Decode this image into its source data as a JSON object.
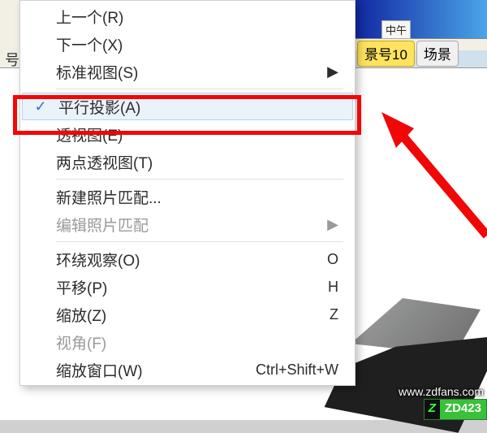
{
  "app": {
    "time_indicator": "中午"
  },
  "toolbar": {
    "tab_active": "景号10",
    "tab_next": "场景",
    "left_label": "号"
  },
  "menu": {
    "items": [
      {
        "label": "上一个(R)",
        "shortcut": "",
        "checked": false,
        "disabled": false
      },
      {
        "label": "下一个(X)",
        "shortcut": "",
        "checked": false,
        "disabled": false
      },
      {
        "label": "标准视图(S)",
        "shortcut": "",
        "checked": false,
        "disabled": false,
        "submenu": true
      }
    ],
    "sep1": true,
    "items2": [
      {
        "label": "平行投影(A)",
        "shortcut": "",
        "checked": true,
        "disabled": false
      },
      {
        "label": "透视图(E)",
        "shortcut": "",
        "checked": false,
        "disabled": false
      },
      {
        "label": "两点透视图(T)",
        "shortcut": "",
        "checked": false,
        "disabled": false
      }
    ],
    "sep2": true,
    "items3": [
      {
        "label": "新建照片匹配...",
        "shortcut": "",
        "checked": false,
        "disabled": false
      },
      {
        "label": "编辑照片匹配",
        "shortcut": "",
        "checked": false,
        "disabled": true,
        "submenu": true
      }
    ],
    "sep3": true,
    "items4": [
      {
        "label": "环绕观察(O)",
        "shortcut": "O",
        "checked": false,
        "disabled": false
      },
      {
        "label": "平移(P)",
        "shortcut": "H",
        "checked": false,
        "disabled": false
      },
      {
        "label": "缩放(Z)",
        "shortcut": "Z",
        "checked": false,
        "disabled": false
      },
      {
        "label": "视角(F)",
        "shortcut": "",
        "checked": false,
        "disabled": true
      },
      {
        "label": "缩放窗口(W)",
        "shortcut": "Ctrl+Shift+W",
        "checked": false,
        "disabled": false
      }
    ]
  },
  "watermark": {
    "badge_z": "Z",
    "badge_text": "ZD423",
    "url": "www.zdfans.com"
  },
  "annotation": {
    "highlight_label": "平行投影(A)"
  }
}
